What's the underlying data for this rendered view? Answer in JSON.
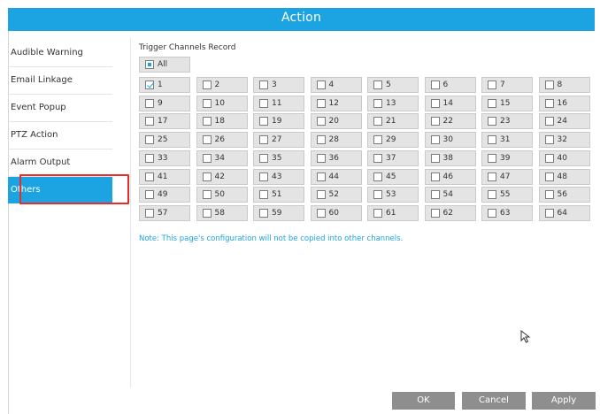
{
  "window": {
    "title": "Action"
  },
  "sidebar": {
    "items": [
      {
        "label": "Audible Warning"
      },
      {
        "label": "Email Linkage"
      },
      {
        "label": "Event Popup"
      },
      {
        "label": "PTZ Action"
      },
      {
        "label": "Alarm Output"
      },
      {
        "label": "Others"
      }
    ],
    "active": "Others"
  },
  "trigger": {
    "section_label": "Trigger Channels Record",
    "all_label": "All",
    "all_state": "partial",
    "channels": [
      "1",
      "2",
      "3",
      "4",
      "5",
      "6",
      "7",
      "8",
      "9",
      "10",
      "11",
      "12",
      "13",
      "14",
      "15",
      "16",
      "17",
      "18",
      "19",
      "20",
      "21",
      "22",
      "23",
      "24",
      "25",
      "26",
      "27",
      "28",
      "29",
      "30",
      "31",
      "32",
      "33",
      "34",
      "35",
      "36",
      "37",
      "38",
      "39",
      "40",
      "41",
      "42",
      "43",
      "44",
      "45",
      "46",
      "47",
      "48",
      "49",
      "50",
      "51",
      "52",
      "53",
      "54",
      "55",
      "56",
      "57",
      "58",
      "59",
      "60",
      "61",
      "62",
      "63",
      "64"
    ],
    "checked": [
      "1"
    ]
  },
  "note": "Note: This page's configuration will not be copied into other channels.",
  "buttons": {
    "ok": "OK",
    "cancel": "Cancel",
    "apply": "Apply"
  },
  "colors": {
    "accent": "#1ca3e2",
    "highlight_border": "#e52d2d",
    "button_bg": "#8e8e8e"
  },
  "icons": {
    "cursor": "mouse-pointer-icon"
  }
}
